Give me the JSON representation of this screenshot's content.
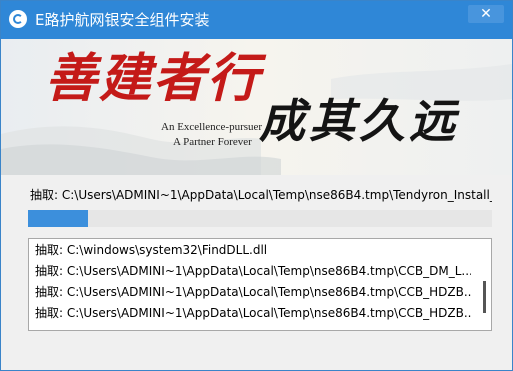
{
  "window": {
    "title": "E路护航网银安全组件安装",
    "close_label": "✕"
  },
  "banner": {
    "slogan_red": "善建者行",
    "slogan_black": "成其久远",
    "tagline_1": "An Excellence-pursuer",
    "tagline_2": "A Partner Forever",
    "colors": {
      "red": "#c41a18",
      "black": "#141414"
    }
  },
  "status": {
    "text": "抽取: C:\\Users\\ADMINI~1\\AppData\\Local\\Temp\\nse86B4.tmp\\Tendyron_Install_!"
  },
  "progress": {
    "percent": 13
  },
  "log": {
    "lines": [
      "抽取: C:\\windows\\system32\\FindDLL.dll",
      "抽取: C:\\Users\\ADMINI~1\\AppData\\Local\\Temp\\nse86B4.tmp\\CCB_DM_L...",
      "抽取: C:\\Users\\ADMINI~1\\AppData\\Local\\Temp\\nse86B4.tmp\\CCB_HDZB...",
      "抽取: C:\\Users\\ADMINI~1\\AppData\\Local\\Temp\\nse86B4.tmp\\CCB_HDZB..."
    ]
  },
  "accent_color": "#2f87d7"
}
